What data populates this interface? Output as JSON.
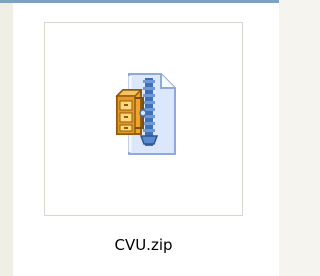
{
  "file": {
    "name": "CVU.zip",
    "icon": "zip-archive-icon"
  },
  "colors": {
    "window_background": "#ffffff",
    "left_pane": "#f0efe5",
    "top_border": "#7fa2c3",
    "thumbnail_border": "#d9d6cb",
    "icon_page": "#dde7fb",
    "icon_page_edge": "#8fa8d8",
    "icon_cabinet": "#f2a32b",
    "icon_zipper": "#3f6fb5"
  }
}
